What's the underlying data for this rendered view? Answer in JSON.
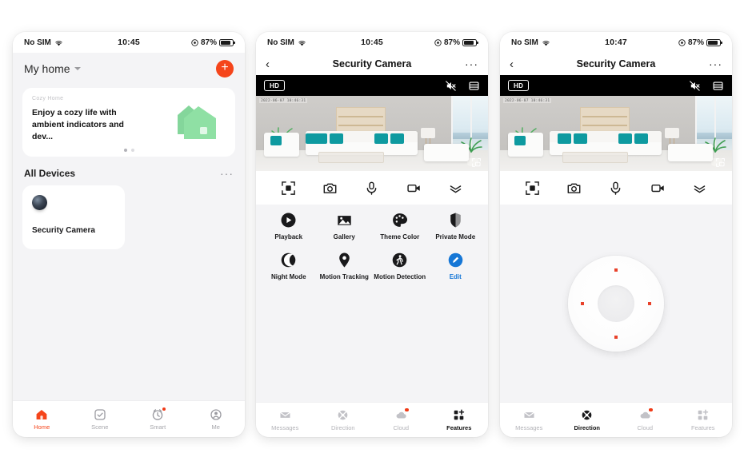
{
  "statusbar": {
    "carrier": "No SIM",
    "time_home": "10:45",
    "time_camera": "10:45",
    "time_direction": "10:47",
    "battery": "87%"
  },
  "phone_home": {
    "home_name": "My home",
    "add_label": "+",
    "banner": {
      "kicker": "Cozy Home",
      "headline": "Enjoy a cozy life with ambient indicators and dev..."
    },
    "section_title": "All Devices",
    "section_more": "···",
    "devices": [
      {
        "name": "Security Camera",
        "icon": "camera-lens-icon"
      }
    ],
    "tabs": [
      {
        "label": "Home",
        "icon": "home-icon",
        "active": true,
        "badge": false
      },
      {
        "label": "Scene",
        "icon": "scene-icon",
        "active": false,
        "badge": false
      },
      {
        "label": "Smart",
        "icon": "smart-icon",
        "active": false,
        "badge": true
      },
      {
        "label": "Me",
        "icon": "person-icon",
        "active": false,
        "badge": false
      }
    ]
  },
  "phone_camera": {
    "nav": {
      "back": "‹",
      "title": "Security Camera",
      "more": "···"
    },
    "video": {
      "quality_badge": "HD",
      "timestamp": "2022-06-07 10:46:31",
      "mute_icon": "speaker-muted-icon",
      "layout_icon": "split-layout-icon",
      "pip_icon": "picture-in-picture-icon"
    },
    "controls": [
      {
        "icon": "fullscreen-icon"
      },
      {
        "icon": "screenshot-camera-icon"
      },
      {
        "icon": "microphone-icon"
      },
      {
        "icon": "record-video-icon"
      },
      {
        "icon": "collapse-chevron-icon"
      }
    ],
    "features": [
      {
        "label": "Playback",
        "icon": "play-circle-icon",
        "accent": false
      },
      {
        "label": "Gallery",
        "icon": "gallery-icon",
        "accent": false
      },
      {
        "label": "Theme Color",
        "icon": "palette-icon",
        "accent": false
      },
      {
        "label": "Private Mode",
        "icon": "shield-private-icon",
        "accent": false
      },
      {
        "label": "Night Mode",
        "icon": "moon-icon",
        "accent": false
      },
      {
        "label": "Motion Tracking",
        "icon": "location-pin-icon",
        "accent": false
      },
      {
        "label": "Motion Detection",
        "icon": "walking-person-icon",
        "accent": false
      },
      {
        "label": "Edit",
        "icon": "pencil-edit-icon",
        "accent": true
      }
    ],
    "tabs": [
      {
        "label": "Messages",
        "icon": "envelope-icon",
        "active": false,
        "badge": false
      },
      {
        "label": "Direction",
        "icon": "direction-icon",
        "active": false,
        "badge": false
      },
      {
        "label": "Cloud",
        "icon": "cloud-icon",
        "active": false,
        "badge": true
      },
      {
        "label": "Features",
        "icon": "grid-icon",
        "active": true,
        "badge": false
      }
    ]
  },
  "phone_direction": {
    "nav": {
      "back": "‹",
      "title": "Security Camera",
      "more": "···"
    },
    "video": {
      "quality_badge": "HD",
      "timestamp": "2022-06-07 10:46:31"
    },
    "dpad": {
      "up_label": "pan-up",
      "down_label": "pan-down",
      "left_label": "pan-left",
      "right_label": "pan-right"
    },
    "tabs": [
      {
        "label": "Messages",
        "icon": "envelope-icon",
        "active": false,
        "badge": false
      },
      {
        "label": "Direction",
        "icon": "direction-icon",
        "active": true,
        "badge": false
      },
      {
        "label": "Cloud",
        "icon": "cloud-icon",
        "active": false,
        "badge": true
      },
      {
        "label": "Features",
        "icon": "grid-icon",
        "active": false,
        "badge": false
      }
    ]
  },
  "colors": {
    "accent_orange": "#f5451b",
    "accent_blue": "#1677d6",
    "badge_red": "#f03a17",
    "pillow_teal": "#0e9aa0",
    "dpad_arrow": "#e8412a"
  }
}
